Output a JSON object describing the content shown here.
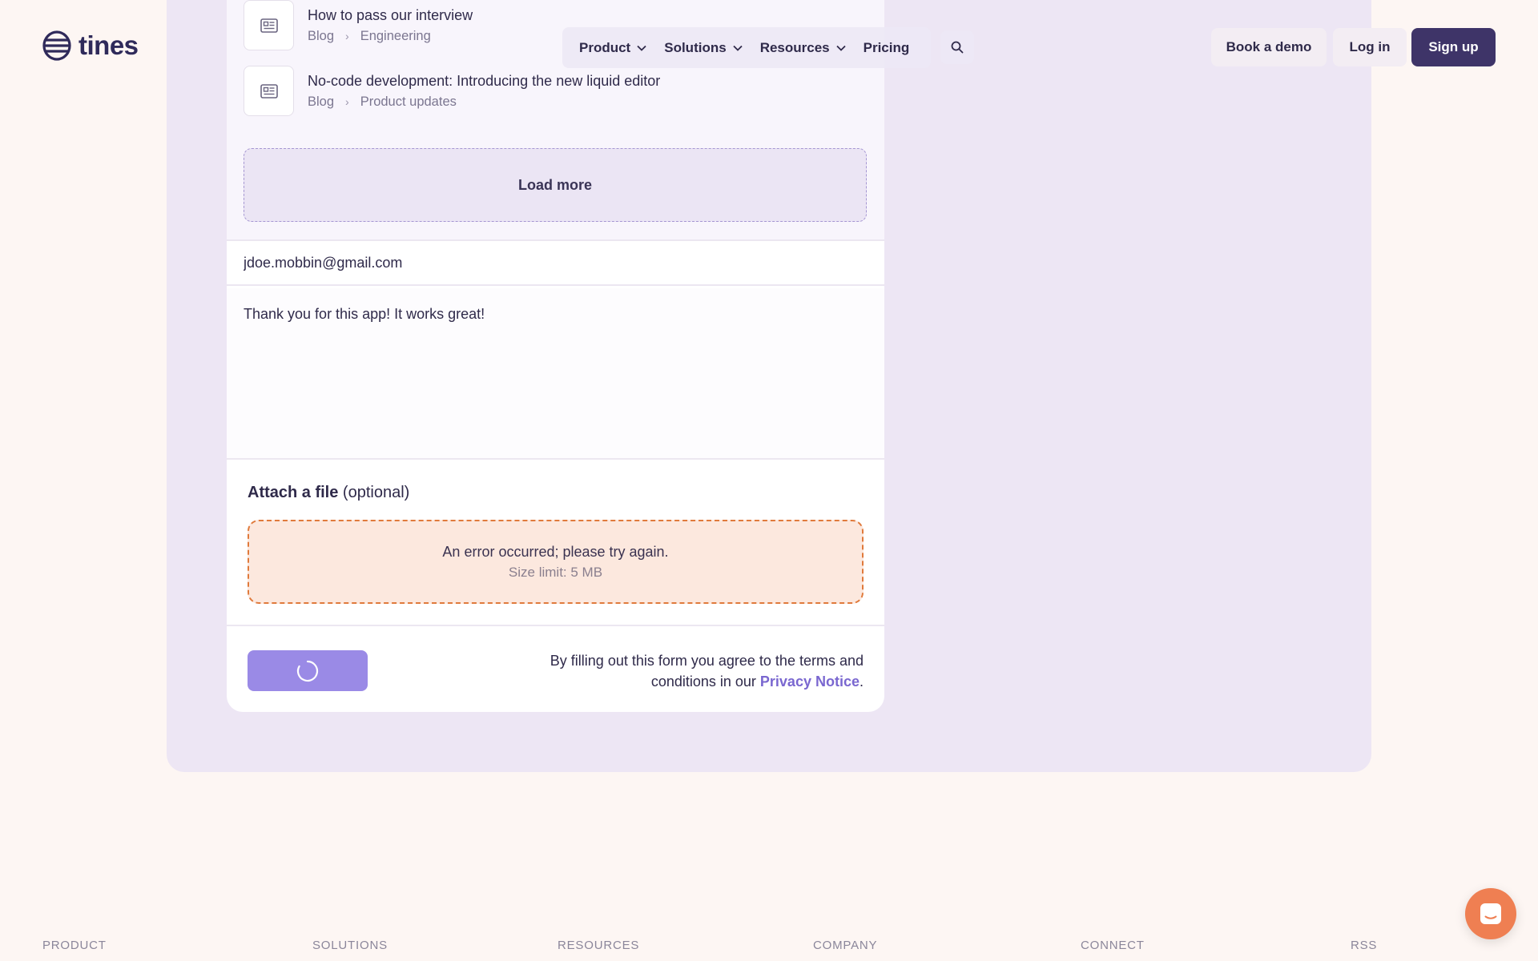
{
  "brand": {
    "name": "tines"
  },
  "nav": {
    "items": [
      {
        "label": "Product",
        "has_dropdown": true
      },
      {
        "label": "Solutions",
        "has_dropdown": true
      },
      {
        "label": "Resources",
        "has_dropdown": true
      },
      {
        "label": "Pricing",
        "has_dropdown": false
      }
    ],
    "search_icon": "search-icon",
    "book_demo": "Book a demo",
    "log_in": "Log in",
    "sign_up": "Sign up"
  },
  "results": [
    {
      "title": "How to pass our interview",
      "crumbs": [
        "Blog",
        "Engineering"
      ],
      "icon": "article-icon"
    },
    {
      "title": "No-code development: Introducing the new liquid editor",
      "crumbs": [
        "Blog",
        "Product updates"
      ],
      "icon": "article-icon"
    }
  ],
  "load_more": "Load more",
  "form": {
    "email_value": "jdoe.mobbin@gmail.com",
    "message_value": "Thank you for this app! It works great!",
    "attach_label_bold": "Attach a file",
    "attach_label_rest": " (optional)",
    "upload_error": "An error occurred; please try again.",
    "size_limit": "Size limit: 5 MB",
    "terms_text": "By filling out this form you agree to the terms and conditions in our ",
    "privacy_link": "Privacy Notice",
    "terms_end": "."
  },
  "footer": {
    "columns": [
      "PRODUCT",
      "SOLUTIONS",
      "RESOURCES",
      "COMPANY",
      "CONNECT",
      "RSS"
    ]
  },
  "colors": {
    "accent": "#7a67d0",
    "brand_dark": "#3e3468",
    "error_border": "#e07a3c",
    "chat": "#ef7f52"
  }
}
